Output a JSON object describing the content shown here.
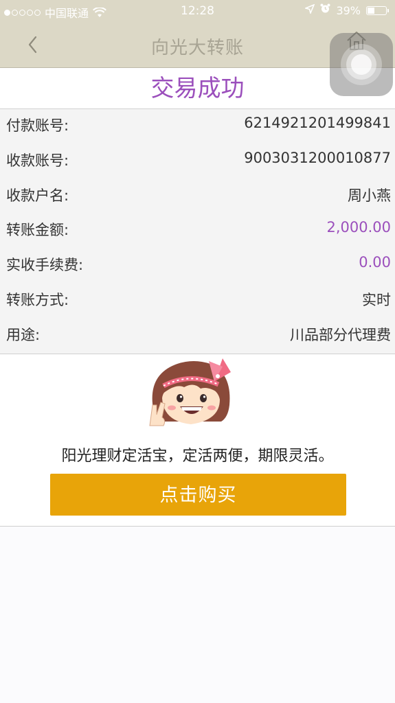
{
  "status_bar": {
    "carrier": "中国联通",
    "time": "12:28",
    "battery": "39%",
    "battery_level": 0.39
  },
  "nav": {
    "title": "向光大转账"
  },
  "result": {
    "title": "交易成功"
  },
  "details": [
    {
      "label": "付款账号:",
      "value": "6214921201499841"
    },
    {
      "label": "收款账号:",
      "value": "9003031200010877"
    },
    {
      "label": "收款户名:",
      "value": "周小燕"
    },
    {
      "label": "转账金额:",
      "value": "2,000.00"
    },
    {
      "label": "实收手续费:",
      "value": "0.00"
    },
    {
      "label": "转账方式:",
      "value": "实时"
    },
    {
      "label": "用途:",
      "value": "川品部分代理费"
    }
  ],
  "promo": {
    "text": "阳光理财定活宝，定活两便，期限灵活。",
    "button_label": "点击购买"
  },
  "colors": {
    "accent_purple": "#9b4fbc",
    "button_orange": "#e8a409",
    "header_bg": "#dcd8c6"
  }
}
